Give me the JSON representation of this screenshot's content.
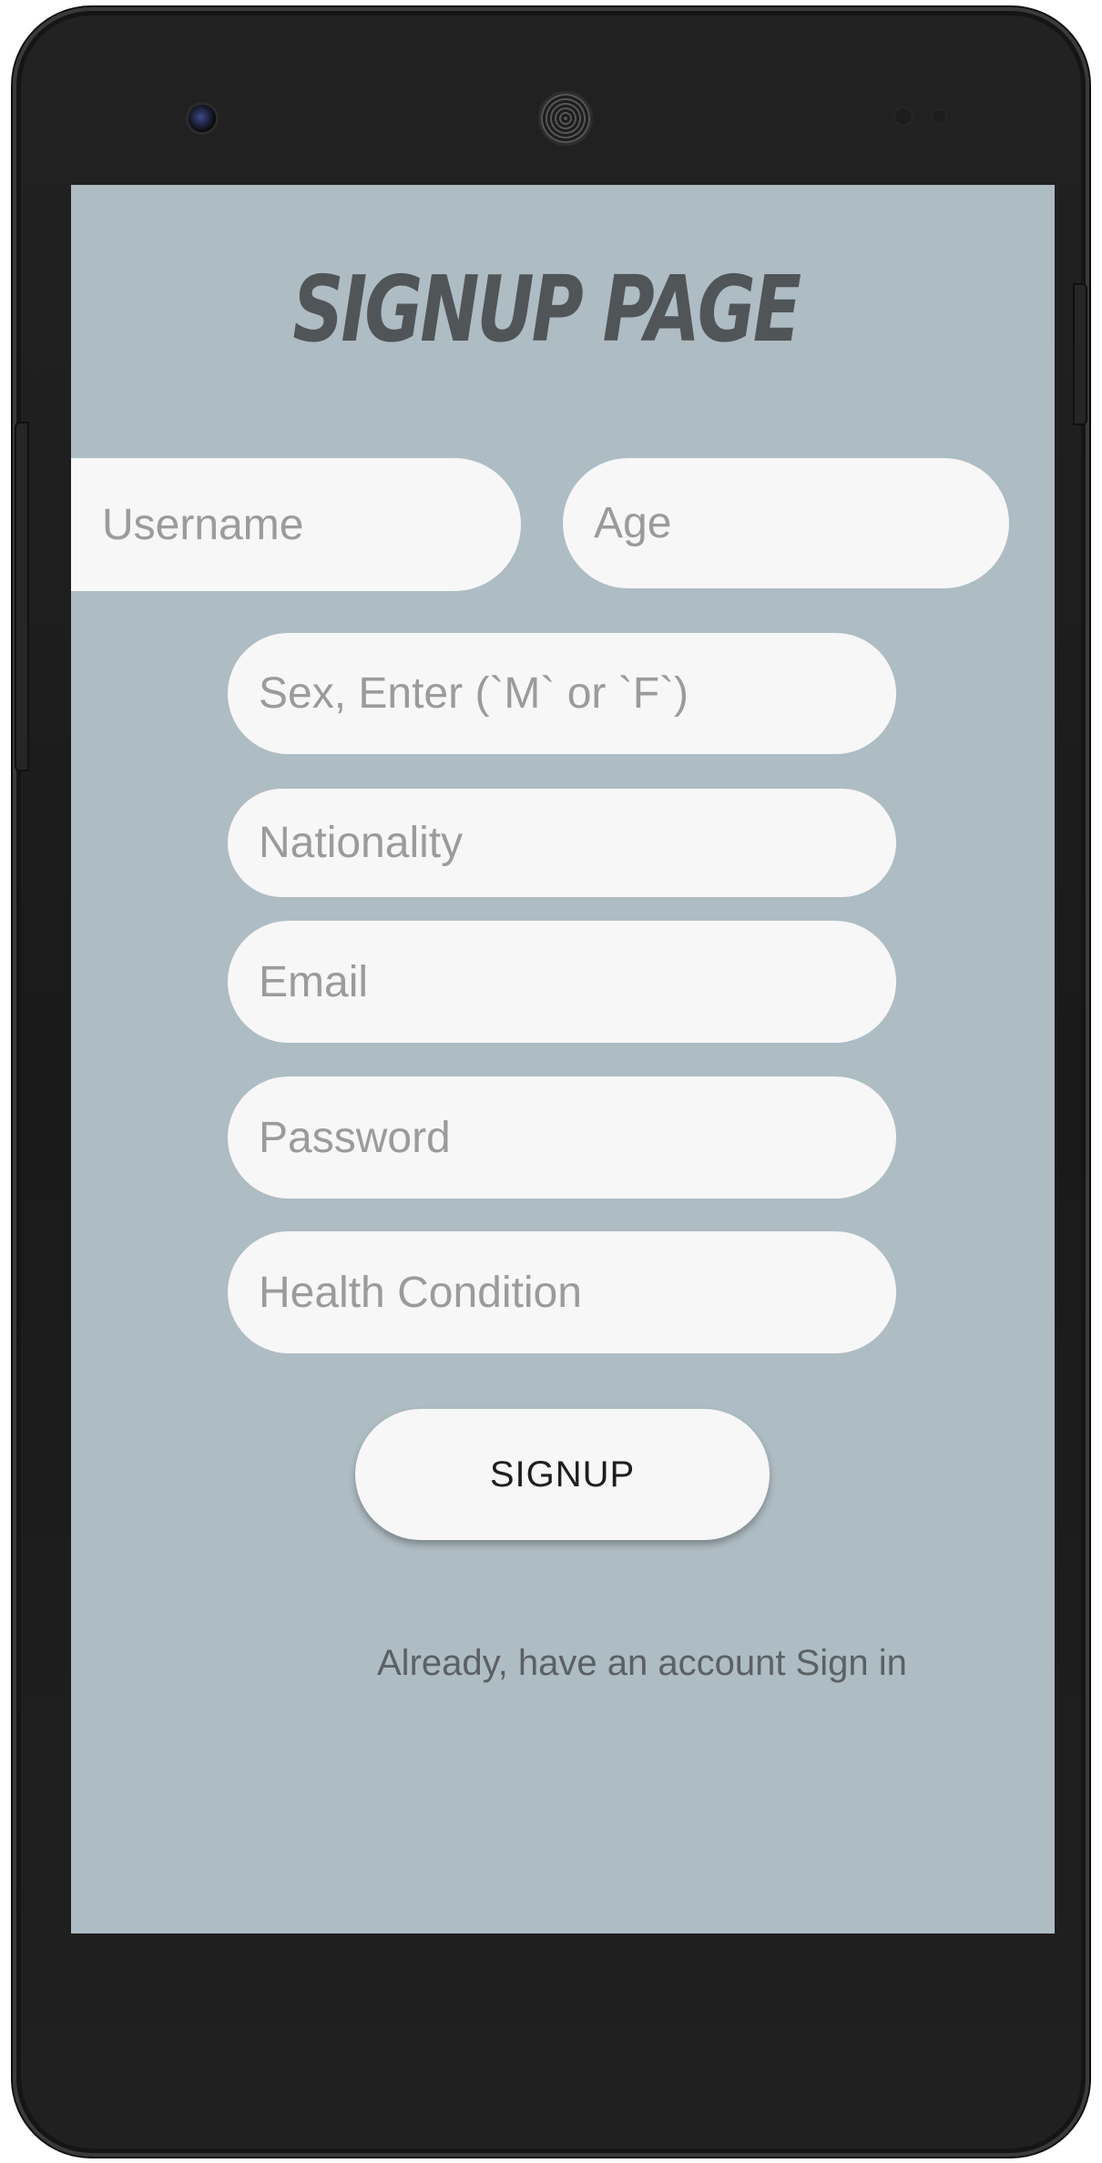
{
  "app": {
    "title": "SIGNUP PAGE"
  },
  "form": {
    "username_placeholder": "Username",
    "age_placeholder": "Age",
    "sex_placeholder": "Sex, Enter (`M` or `F`)",
    "nationality_placeholder": "Nationality",
    "email_placeholder": "Email",
    "password_placeholder": "Password",
    "health_placeholder": "Health Condition",
    "signup_label": "SIGNUP",
    "signin_link": "Already, have an account Sign in"
  },
  "colors": {
    "screen_background": "#aebcc3",
    "field_background": "#f7f7f7",
    "title_color": "#505558",
    "placeholder_color": "#9b9b9b"
  }
}
